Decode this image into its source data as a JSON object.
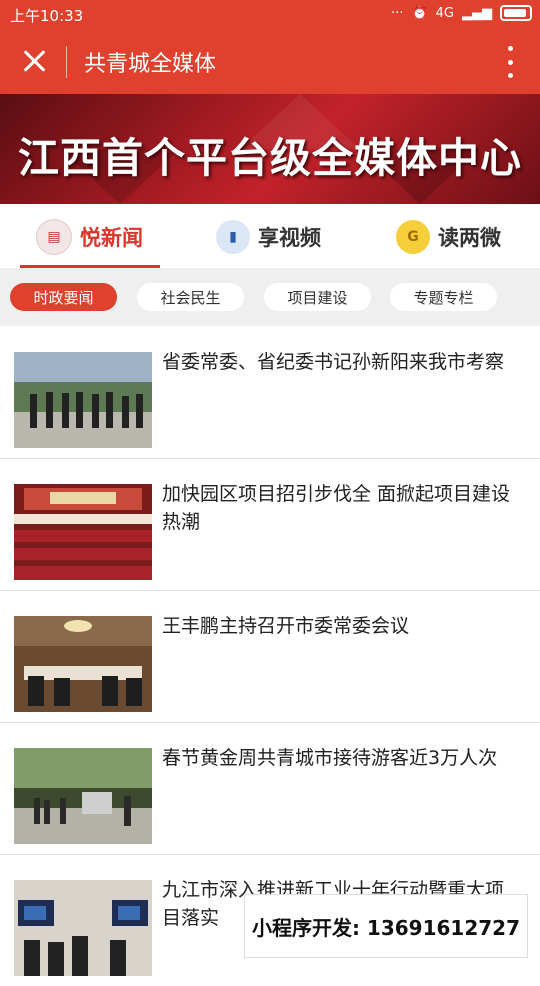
{
  "status_bar": {
    "time": "上午10:33",
    "network": "4G"
  },
  "nav": {
    "title": "共青城全媒体"
  },
  "banner": {
    "text": "江西首个平台级全媒体中心"
  },
  "main_tabs": [
    {
      "label": "悦新闻",
      "icon": "news-icon",
      "active": true
    },
    {
      "label": "享视频",
      "icon": "video-icon",
      "active": false
    },
    {
      "label": "读两微",
      "icon": "weibo-wechat-icon",
      "active": false
    }
  ],
  "sub_tabs": [
    {
      "label": "时政要闻",
      "active": true
    },
    {
      "label": "社会民生",
      "active": false
    },
    {
      "label": "项目建设",
      "active": false
    },
    {
      "label": "专题专栏",
      "active": false
    }
  ],
  "articles": [
    {
      "title": "省委常委、省纪委书记孙新阳来我市考察",
      "thumbnail": "officials-inspection-photo"
    },
    {
      "title": "加快园区项目招引步伐全 面掀起项目建设热潮",
      "thumbnail": "auditorium-meeting-photo"
    },
    {
      "title": "王丰鹏主持召开市委常委会议",
      "thumbnail": "conference-room-photo"
    },
    {
      "title": "春节黄金周共青城市接待游客近3万人次",
      "thumbnail": "tourists-street-photo"
    },
    {
      "title": "九江市深入推进新工业十年行动暨重大项目落实",
      "thumbnail": "video-conference-photo"
    }
  ],
  "watermark": {
    "text": "小程序开发: 13691612727"
  },
  "colors": {
    "brand": "#e0402e",
    "active_text": "#d7372c"
  }
}
